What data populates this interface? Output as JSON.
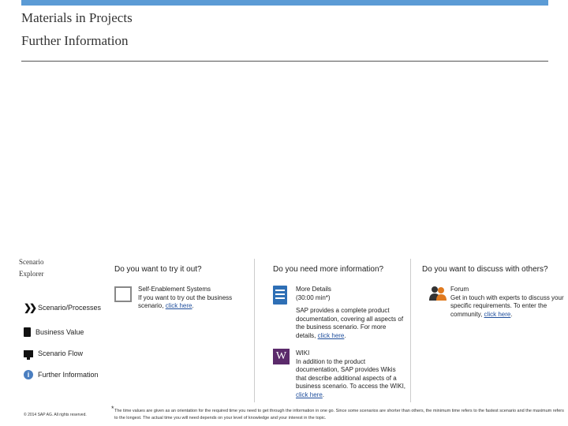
{
  "header": {
    "title": "Materials in Projects",
    "subtitle": "Further Information"
  },
  "sidebar": {
    "title_line1": "Scenario",
    "title_line2": "Explorer",
    "items": [
      {
        "label": "Scenario/Processes",
        "icon": "double-chevron-icon"
      },
      {
        "label": "Business Value",
        "icon": "calculator-icon"
      },
      {
        "label": "Scenario Flow",
        "icon": "monitor-icon"
      },
      {
        "label": "Further Information",
        "icon": "info-icon"
      }
    ],
    "copyright": "© 2014 SAP AG. All rights reserved."
  },
  "columns": {
    "try": {
      "heading": "Do you want to try it out?",
      "item_title": "Self-Enablement Systems",
      "item_text": "If you want to try out the business scenario,",
      "link": "click here",
      "after": "."
    },
    "info": {
      "heading": "Do you need more information?",
      "details_title": "More Details",
      "details_time": "(30:00 min*)",
      "details_text": "SAP provides a complete product documentation, covering all aspects of the business scenario. For more details,",
      "details_link": "click here",
      "details_after": ".",
      "wiki_title": "WIKI",
      "wiki_text": "In addition to the product documentation, SAP provides Wikis that describe additional aspects of a business scenario. To access the WIKI,",
      "wiki_link": "click here",
      "wiki_after": "."
    },
    "discuss": {
      "heading": "Do you want to discuss with others?",
      "forum_title": "Forum",
      "forum_text": "Get in touch with experts to discuss your specific requirements. To enter the community,",
      "forum_link": "click here",
      "forum_after": "."
    }
  },
  "footnote": {
    "star": "*",
    "text": "The time values are given as an orientation for the required time you need to get through the information in one go. Since some scenarios are shorter than others, the minimum time refers to the fastest scenario and the maximum refers to the longest. The actual time you will need depends on your level of knowledge and your interest in the topic."
  },
  "colors": {
    "accent_bar": "#5b9bd5",
    "link": "#1f4e9c",
    "doc_icon": "#2e6fb5",
    "wiki_icon": "#5b2a6b",
    "people_icon": "#e07a1f"
  }
}
